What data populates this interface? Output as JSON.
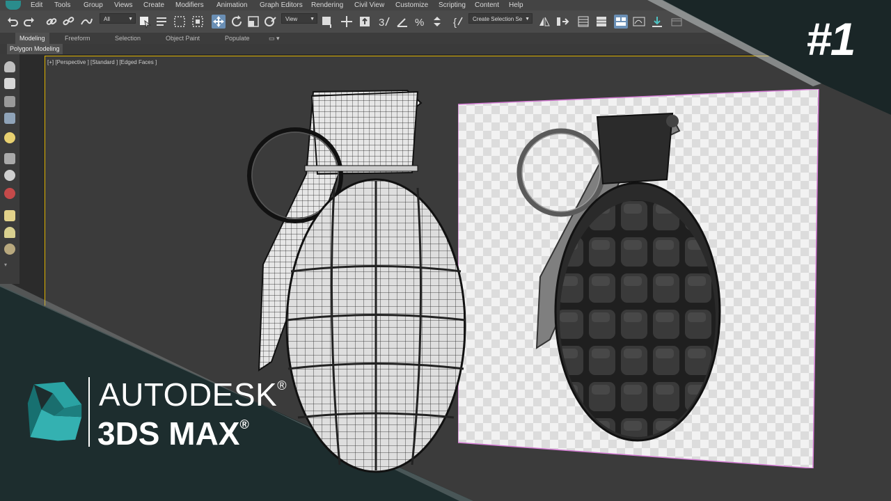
{
  "menu": [
    "Edit",
    "Tools",
    "Group",
    "Views",
    "Create",
    "Modifiers",
    "Animation",
    "Graph Editors",
    "Rendering",
    "Civil View",
    "Customize",
    "Scripting",
    "Content",
    "Help"
  ],
  "toolbar": {
    "filter_dropdown": "All",
    "refcoord_dropdown": "View",
    "selection_set_dropdown": "Create Selection Se"
  },
  "ribbon": {
    "tabs": [
      "Modeling",
      "Freeform",
      "Selection",
      "Object Paint",
      "Populate"
    ],
    "active_tab": "Modeling",
    "panel_label": "Polygon Modeling"
  },
  "viewport": {
    "label": "[+] [Perspective ] [Standard ] [Edged Faces ]"
  },
  "overlay": {
    "episode": "#1",
    "brand_line1": "AUTODESK",
    "brand_line2": "3DS MAX",
    "reg_mark": "®"
  },
  "colors": {
    "accent_teal": "#2a9a9a",
    "viewport_border": "#e0b400",
    "background": "#2b2b2b"
  }
}
